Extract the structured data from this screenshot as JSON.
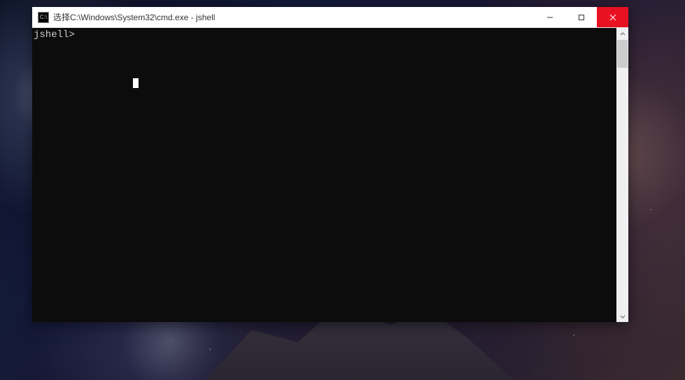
{
  "window": {
    "title": "选择C:\\Windows\\System32\\cmd.exe - jshell",
    "icon_label": "C:\\"
  },
  "terminal": {
    "prompt": "jshell>"
  },
  "controls": {
    "minimize_label": "—",
    "maximize_label": "▢",
    "close_label": "✕"
  }
}
